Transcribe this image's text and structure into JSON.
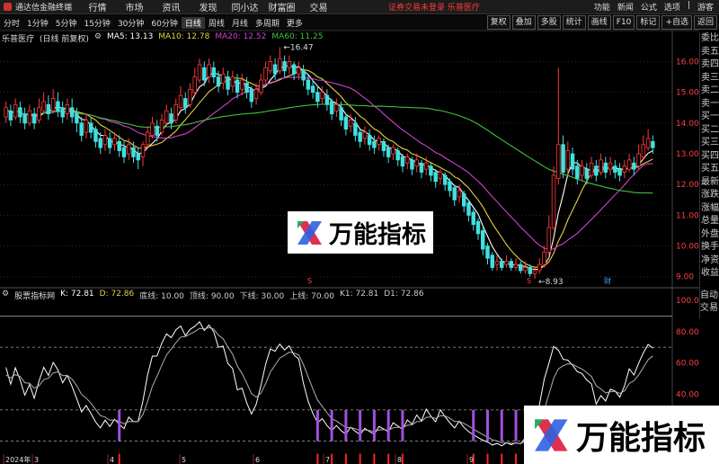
{
  "titlebar": {
    "app_name": "通达信金融终端",
    "menu": [
      "行情",
      "市场",
      "资讯",
      "发现",
      "同小达",
      "财富圈",
      "交易"
    ],
    "notice": "证券交易未登录  乐普医疗",
    "right": [
      "功能",
      "新闻",
      "公式",
      "选项",
      "|",
      "游客"
    ]
  },
  "periods": [
    "分时",
    "1分钟",
    "5分钟",
    "15分钟",
    "30分钟",
    "60分钟",
    "日线",
    "周线",
    "月线",
    "多周期",
    "更多"
  ],
  "selected_period": "日线",
  "tools": [
    "复权",
    "叠加",
    "多股",
    "统计",
    "画线",
    "F10",
    "标记",
    "+自选",
    "返回"
  ],
  "right_panel": [
    "委比",
    "卖五",
    "卖四",
    "卖三",
    "卖二",
    "卖一",
    "买一",
    "买二",
    "买三",
    "买四",
    "买五",
    "最新",
    "涨跌",
    "涨幅",
    "总量",
    "外盘",
    "换手",
    "净资",
    "收益"
  ],
  "right_panel2": [
    "自动",
    "交易"
  ],
  "price_legend": {
    "name": "乐普医疗",
    "mode": "(日线 前复权)",
    "ma5": "MA5: 13.13",
    "ma10": "MA10: 12.78",
    "ma20": "MA20: 12.52",
    "ma60": "MA60: 11.25"
  },
  "indicator_legend": {
    "name": "股票指标网",
    "items": [
      "K: 72.81",
      "D: 72.86",
      "底线: 10.00",
      "顶线: 90.00",
      "下线: 30.00",
      "上线: 70.00",
      "K1: 72.81",
      "D1: 72.86"
    ]
  },
  "price_axis": [
    "16.00",
    "15.00",
    "14.00",
    "13.00",
    "12.00",
    "11.00",
    "10.00",
    "9.00"
  ],
  "indicator_axis": [
    "100.0",
    "80.00",
    "60.00",
    "40.00",
    "20.00"
  ],
  "annotations": {
    "high": "16.47",
    "low": "8.93",
    "cai": "财",
    "s1": "S",
    "s2": "S"
  },
  "time_axis": [
    "2024年",
    "3",
    "4",
    "5",
    "6",
    "7",
    "8",
    "9",
    "10"
  ],
  "watermark": "万能指标",
  "colors": {
    "up": "#ff3b3b",
    "down": "#40e0e0",
    "ma5": "#ffffff",
    "ma10": "#e8d040",
    "ma20": "#d040d0",
    "ma60": "#40c040",
    "purple": "#a050e0",
    "blue": "#4060ff"
  }
}
